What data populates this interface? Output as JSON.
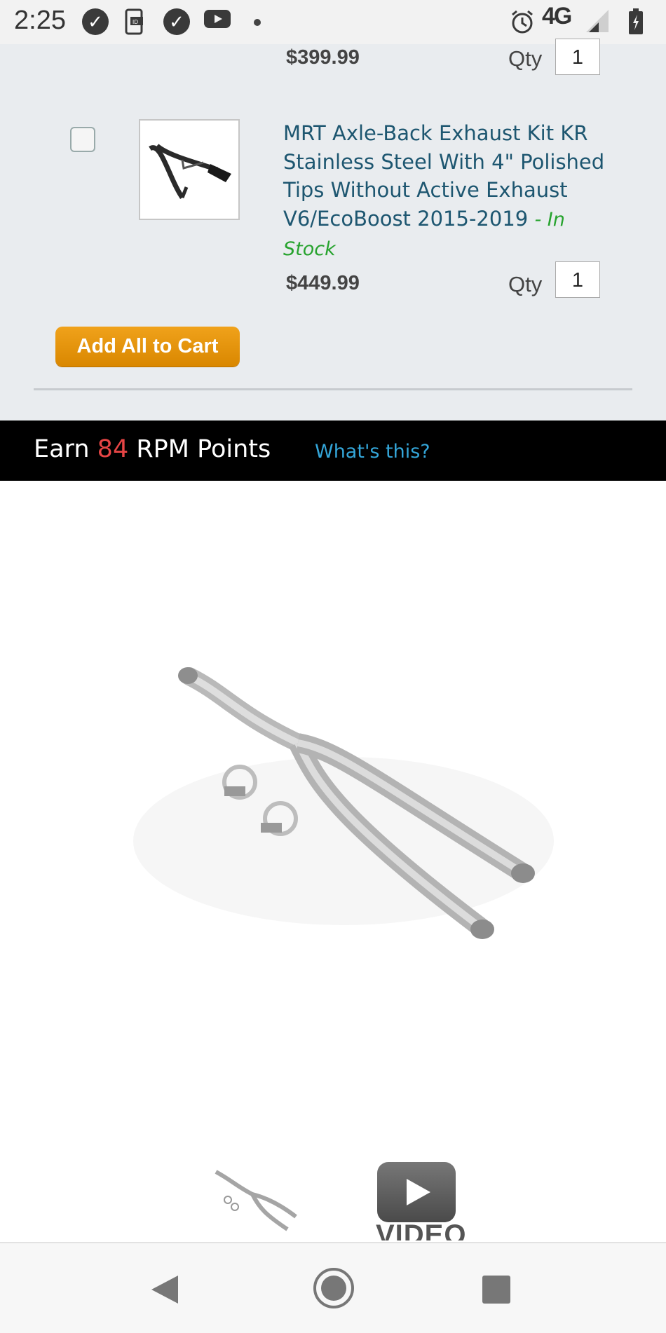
{
  "status_bar": {
    "time": "2:25",
    "network": "4G",
    "icons": [
      "check-circle-icon",
      "phone-id-icon",
      "check-circle-icon",
      "youtube-icon",
      "dot-icon",
      "alarm-icon",
      "signal-icon",
      "battery-icon"
    ]
  },
  "cart": {
    "previous_item": {
      "price": "$399.99",
      "qty_label": "Qty",
      "qty": "1"
    },
    "item": {
      "title": "MRT Axle-Back Exhaust Kit KR Stainless Steel With 4\" Polished Tips Without Active Exhaust V6/EcoBoost 2015-2019",
      "stock": "- In Stock",
      "price": "$449.99",
      "qty_label": "Qty",
      "qty": "1"
    },
    "add_all_label": "Add All to Cart",
    "colors": {
      "button": "#e69300",
      "stock": "#27a32e",
      "link": "#1d5670"
    }
  },
  "rewards": {
    "earn": "Earn",
    "points": "84",
    "suffix": "RPM Points",
    "link": "What's this?"
  },
  "gallery": {
    "video_label": "VIDEO"
  },
  "nav": {
    "buttons": [
      "back-icon",
      "home-icon",
      "recents-icon"
    ]
  }
}
